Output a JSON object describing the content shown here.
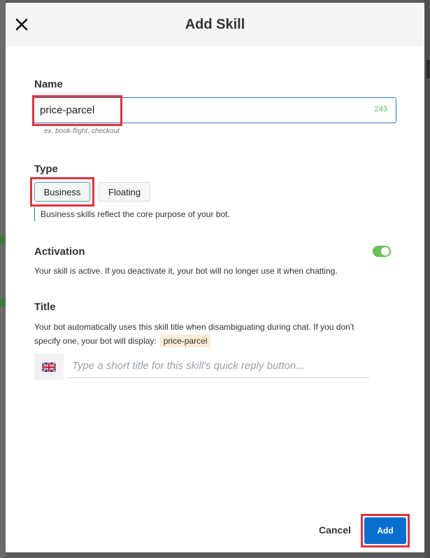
{
  "dialog": {
    "title": "Add Skill",
    "close_icon": "close-icon"
  },
  "name": {
    "label": "Name",
    "value": "price-parcel",
    "char_count": "243",
    "hint": "ex. book-flight, checkout"
  },
  "type": {
    "label": "Type",
    "options": [
      "Business",
      "Floating"
    ],
    "selected": "Business",
    "description": "Business skills reflect the core purpose of your bot."
  },
  "activation": {
    "label": "Activation",
    "enabled": true,
    "description": "Your skill is active. If you deactivate it, your bot will no longer use it when chatting."
  },
  "title_section": {
    "label": "Title",
    "description_line1": "Your bot automatically uses this skill title when disambiguating during chat. If you don't",
    "description_line2": "specify one, your bot will display:",
    "default_tag": "price-parcel",
    "language_icon": "uk-flag-icon",
    "placeholder": "Type a short title for this skill's quick reply button..."
  },
  "footer": {
    "cancel_label": "Cancel",
    "add_label": "Add"
  },
  "colors": {
    "primary": "#0a6ed1",
    "toggle_on": "#6bbf59",
    "highlight": "#e0333f",
    "tag_bg": "#fbedd6"
  }
}
